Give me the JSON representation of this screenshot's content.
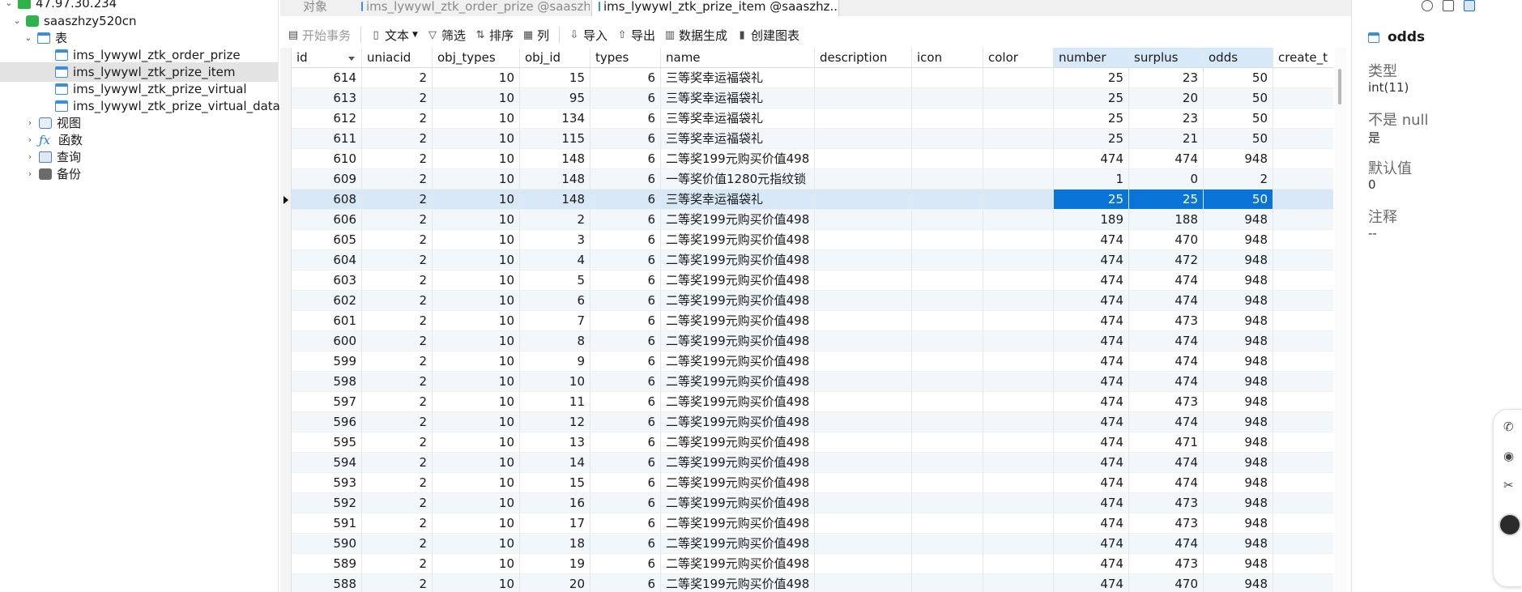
{
  "tree": {
    "connection": "47.97.30.234",
    "database": "saaszhzy520cn",
    "tables_folder": "表",
    "tables": [
      "ims_lywywl_ztk_order_prize",
      "ims_lywywl_ztk_prize_item",
      "ims_lywywl_ztk_prize_virtual",
      "ims_lywywl_ztk_prize_virtual_data"
    ],
    "views": "视图",
    "functions": "函数",
    "queries": "查询",
    "backups": "备份"
  },
  "tabs": [
    {
      "label": "对象"
    },
    {
      "label": "ims_lywywl_ztk_order_prize @saaszh..."
    },
    {
      "label": "ims_lywywl_ztk_prize_item @saaszhz..."
    }
  ],
  "toolbar": {
    "begin_txn": "开始事务",
    "text": "文本",
    "filter": "筛选",
    "sort": "排序",
    "columns": "列",
    "import": "导入",
    "export": "导出",
    "data_gen": "数据生成",
    "create_chart": "创建图表"
  },
  "grid": {
    "columns": [
      "id",
      "uniacid",
      "obj_types",
      "obj_id",
      "types",
      "name",
      "description",
      "icon",
      "color",
      "number",
      "surplus",
      "odds",
      "create_t"
    ],
    "rows": [
      [
        "614",
        "2",
        "10",
        "15",
        "6",
        "三等奖幸运福袋礼",
        "",
        "",
        "",
        "25",
        "23",
        "50"
      ],
      [
        "613",
        "2",
        "10",
        "95",
        "6",
        "三等奖幸运福袋礼",
        "",
        "",
        "",
        "25",
        "20",
        "50"
      ],
      [
        "612",
        "2",
        "10",
        "134",
        "6",
        "三等奖幸运福袋礼",
        "",
        "",
        "",
        "25",
        "23",
        "50"
      ],
      [
        "611",
        "2",
        "10",
        "115",
        "6",
        "三等奖幸运福袋礼",
        "",
        "",
        "",
        "25",
        "21",
        "50"
      ],
      [
        "610",
        "2",
        "10",
        "148",
        "6",
        "二等奖199元购买价值498",
        "",
        "",
        "",
        "474",
        "474",
        "948"
      ],
      [
        "609",
        "2",
        "10",
        "148",
        "6",
        "一等奖价值1280元指纹锁",
        "",
        "",
        "",
        "1",
        "0",
        "2"
      ],
      [
        "608",
        "2",
        "10",
        "148",
        "6",
        "三等奖幸运福袋礼",
        "",
        "",
        "",
        "25",
        "25",
        "50"
      ],
      [
        "606",
        "2",
        "10",
        "2",
        "6",
        "二等奖199元购买价值498",
        "",
        "",
        "",
        "189",
        "188",
        "948"
      ],
      [
        "605",
        "2",
        "10",
        "3",
        "6",
        "二等奖199元购买价值498",
        "",
        "",
        "",
        "474",
        "470",
        "948"
      ],
      [
        "604",
        "2",
        "10",
        "4",
        "6",
        "二等奖199元购买价值498",
        "",
        "",
        "",
        "474",
        "472",
        "948"
      ],
      [
        "603",
        "2",
        "10",
        "5",
        "6",
        "二等奖199元购买价值498",
        "",
        "",
        "",
        "474",
        "474",
        "948"
      ],
      [
        "602",
        "2",
        "10",
        "6",
        "6",
        "二等奖199元购买价值498",
        "",
        "",
        "",
        "474",
        "474",
        "948"
      ],
      [
        "601",
        "2",
        "10",
        "7",
        "6",
        "二等奖199元购买价值498",
        "",
        "",
        "",
        "474",
        "473",
        "948"
      ],
      [
        "600",
        "2",
        "10",
        "8",
        "6",
        "二等奖199元购买价值498",
        "",
        "",
        "",
        "474",
        "474",
        "948"
      ],
      [
        "599",
        "2",
        "10",
        "9",
        "6",
        "二等奖199元购买价值498",
        "",
        "",
        "",
        "474",
        "474",
        "948"
      ],
      [
        "598",
        "2",
        "10",
        "10",
        "6",
        "二等奖199元购买价值498",
        "",
        "",
        "",
        "474",
        "474",
        "948"
      ],
      [
        "597",
        "2",
        "10",
        "11",
        "6",
        "二等奖199元购买价值498",
        "",
        "",
        "",
        "474",
        "473",
        "948"
      ],
      [
        "596",
        "2",
        "10",
        "12",
        "6",
        "二等奖199元购买价值498",
        "",
        "",
        "",
        "474",
        "474",
        "948"
      ],
      [
        "595",
        "2",
        "10",
        "13",
        "6",
        "二等奖199元购买价值498",
        "",
        "",
        "",
        "474",
        "471",
        "948"
      ],
      [
        "594",
        "2",
        "10",
        "14",
        "6",
        "二等奖199元购买价值498",
        "",
        "",
        "",
        "474",
        "474",
        "948"
      ],
      [
        "593",
        "2",
        "10",
        "15",
        "6",
        "二等奖199元购买价值498",
        "",
        "",
        "",
        "474",
        "474",
        "948"
      ],
      [
        "592",
        "2",
        "10",
        "16",
        "6",
        "二等奖199元购买价值498",
        "",
        "",
        "",
        "474",
        "473",
        "948"
      ],
      [
        "591",
        "2",
        "10",
        "17",
        "6",
        "二等奖199元购买价值498",
        "",
        "",
        "",
        "474",
        "473",
        "948"
      ],
      [
        "590",
        "2",
        "10",
        "18",
        "6",
        "二等奖199元购买价值498",
        "",
        "",
        "",
        "474",
        "474",
        "948"
      ],
      [
        "589",
        "2",
        "10",
        "19",
        "6",
        "二等奖199元购买价值498",
        "",
        "",
        "",
        "474",
        "473",
        "948"
      ],
      [
        "588",
        "2",
        "10",
        "20",
        "6",
        "二等奖199元购买价值498",
        "",
        "",
        "",
        "474",
        "470",
        "948"
      ]
    ]
  },
  "panel": {
    "title": "odds",
    "type_label": "类型",
    "type_value": "int(11)",
    "notnull_label": "不是 null",
    "notnull_value": "是",
    "default_label": "默认值",
    "default_value": "0",
    "comment_label": "注释",
    "comment_value": "--"
  },
  "colors": {
    "selection": "#0a74d6",
    "annotation": "#e8282a",
    "selected_row": "#d9e8f6"
  }
}
